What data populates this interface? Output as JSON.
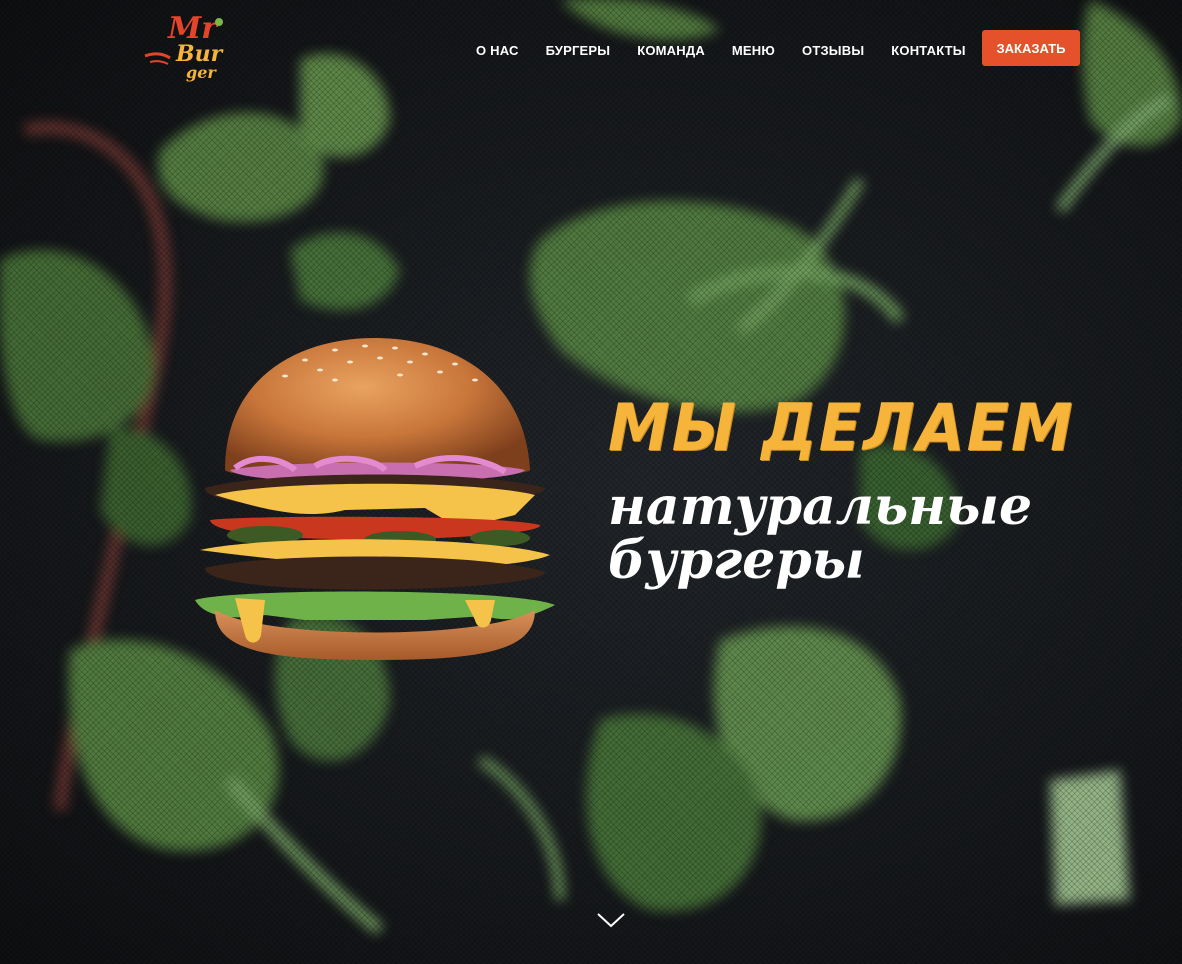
{
  "brand": {
    "logo_text_line1": "Mr",
    "logo_text_line2": "Bur",
    "logo_text_line3": "ger",
    "colors": {
      "logo_red": "#e4452a",
      "logo_yellow": "#f6b53a",
      "logo_green": "#7ab648"
    }
  },
  "nav": {
    "items": [
      {
        "label": "О НАС"
      },
      {
        "label": "БУРГЕРЫ"
      },
      {
        "label": "КОМАНДА"
      },
      {
        "label": "МЕНЮ"
      },
      {
        "label": "ОТЗЫВЫ"
      },
      {
        "label": "КОНТАКТЫ"
      }
    ],
    "order_button": "ЗАКАЗАТЬ"
  },
  "hero": {
    "headline_line1": "МЫ ДЕЛАЕМ",
    "headline_line2": "натуральные бургеры",
    "image": "burger-image",
    "scroll_icon": "chevron-down-icon",
    "colors": {
      "accent": "#f6b53a",
      "button": "#e4512a",
      "background": "#15171a"
    }
  }
}
